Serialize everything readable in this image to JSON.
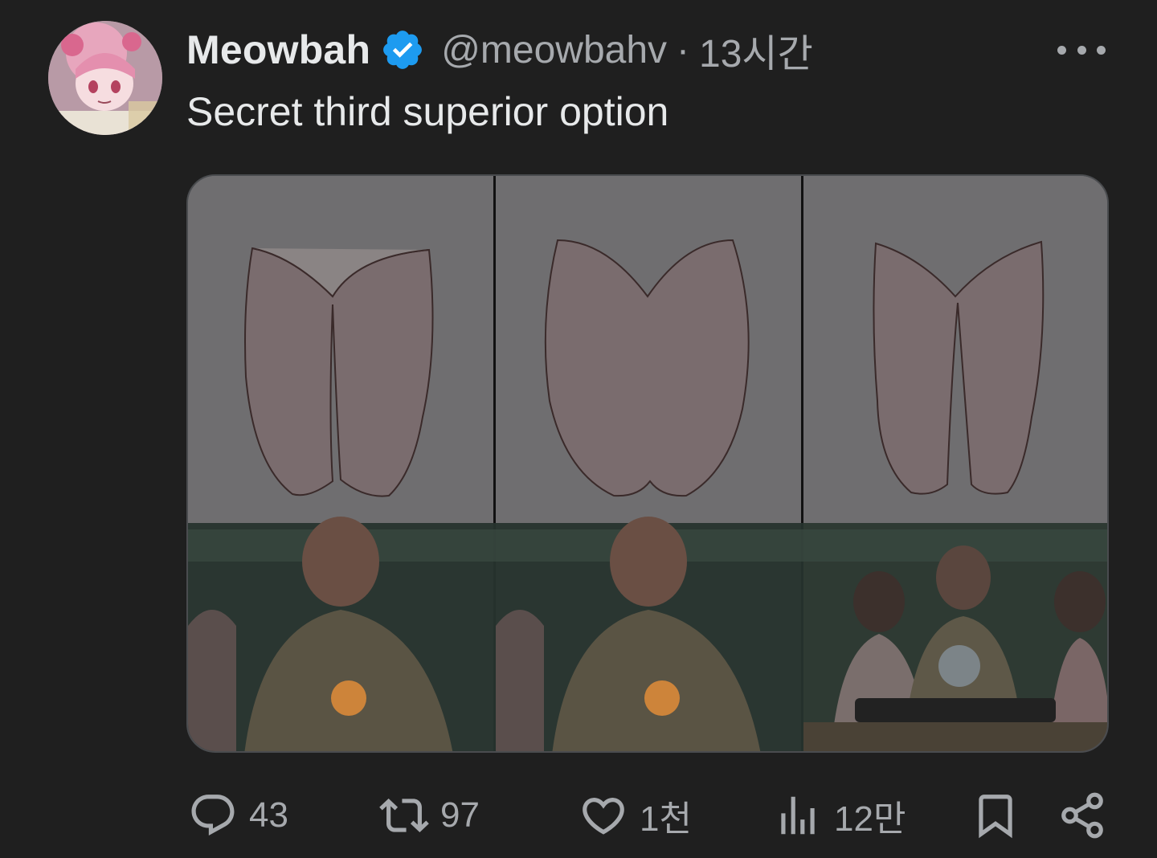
{
  "author": {
    "display_name": "Meowbah",
    "handle": "@meowbahv",
    "separator": "·",
    "time": "13시간",
    "verified": true,
    "avatar_icon": "anime-avatar-icon"
  },
  "tweet": {
    "text": "Secret third superior option"
  },
  "media": {
    "panels": 3,
    "description_icons": [
      "thigh-drawing",
      "man-heartburn-still"
    ]
  },
  "actions": {
    "replies": "43",
    "reposts": "97",
    "likes": "1천",
    "views": "12만"
  },
  "colors": {
    "background": "#1f1f1f",
    "text": "#e7e9ea",
    "muted": "#a6a9ad",
    "verified": "#1d9bf0"
  }
}
